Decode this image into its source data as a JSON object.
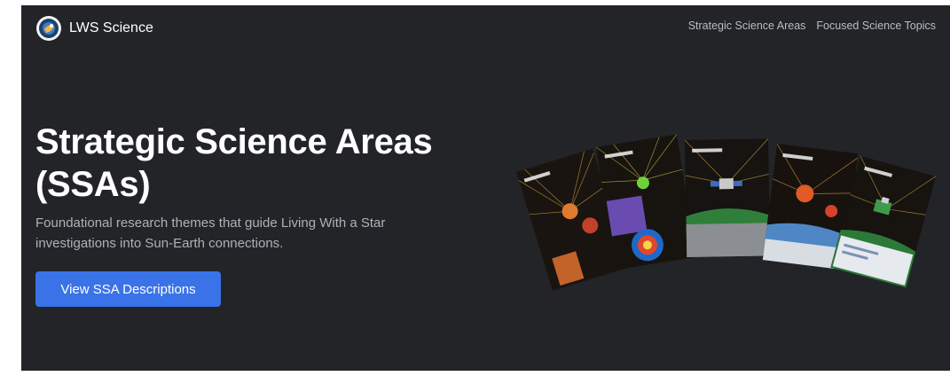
{
  "brand": {
    "name": "LWS Science"
  },
  "nav": {
    "links": [
      "Strategic Science Areas",
      "Focused Science Topics"
    ]
  },
  "hero": {
    "title": "Strategic Science Areas (SSAs)",
    "subtitle": "Foundational research themes that guide Living With a Star investigations into Sun-Earth connections.",
    "cta_label": "View SSA Descriptions"
  },
  "colors": {
    "background": "#222428",
    "accent": "#3a73e8",
    "heading": "#ffffff",
    "muted_text": "#aeb1b7"
  },
  "graphic": {
    "description_icon": "ssa-cover-fan-image",
    "cover_count": 5
  }
}
